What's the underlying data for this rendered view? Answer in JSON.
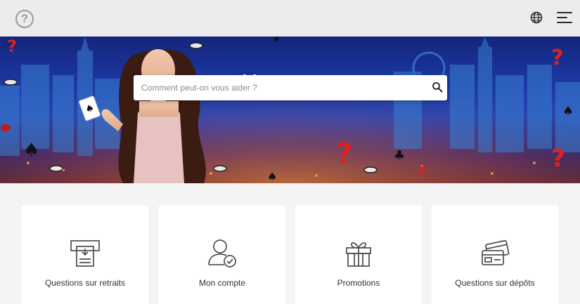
{
  "topbar": {
    "help_icon": "question-circle-icon",
    "help_glyph": "?",
    "language_icon": "globe-icon",
    "menu_icon": "hamburger-menu-icon"
  },
  "hero": {
    "title": "Aide et support",
    "search": {
      "placeholder": "Comment peut-on vous aider ?",
      "value": "",
      "icon": "search-icon"
    }
  },
  "categories": [
    {
      "label": "Questions sur retraits",
      "icon": "atm-withdrawal-icon"
    },
    {
      "label": "Mon compte",
      "icon": "user-check-icon"
    },
    {
      "label": "Promotions",
      "icon": "gift-icon"
    },
    {
      "label": "Questions sur dépôts",
      "icon": "credit-cards-icon"
    }
  ],
  "colors": {
    "topbar_bg": "#ebeced",
    "page_bg": "#f4f4f4",
    "card_bg": "#ffffff",
    "hero_blue": "#1d3aa8",
    "accent_red": "#e0201c",
    "icon_gray": "#555555"
  }
}
